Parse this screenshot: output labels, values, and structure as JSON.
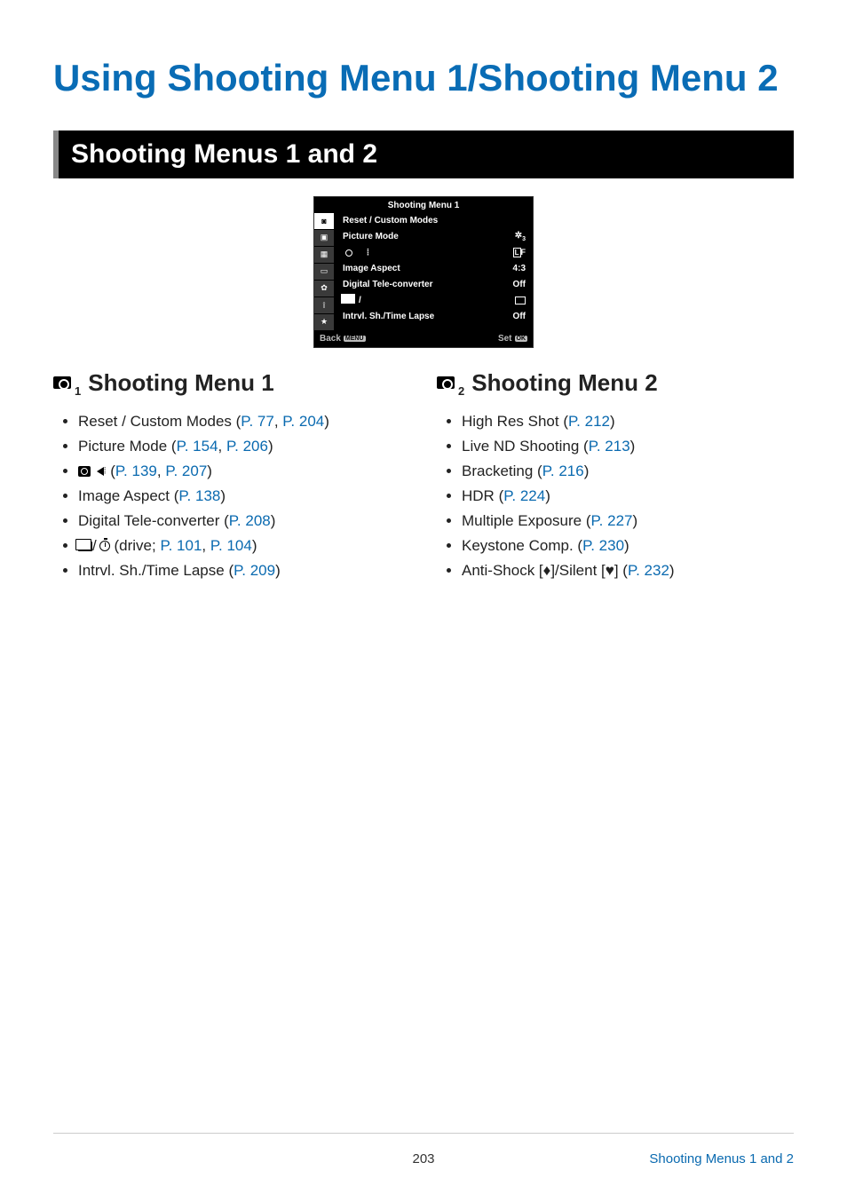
{
  "title": "Using Shooting Menu 1/Shooting Menu 2",
  "section_heading": "Shooting Menus 1 and 2",
  "lcd": {
    "title": "Shooting Menu 1",
    "rows": [
      {
        "label": "Reset / Custom Modes",
        "value": ""
      },
      {
        "label": "Picture Mode",
        "value": "icon-picmode"
      },
      {
        "label": "icon-quality",
        "value": "LF"
      },
      {
        "label": "Image Aspect",
        "value": "4:3"
      },
      {
        "label": "Digital Tele-converter",
        "value": "Off"
      },
      {
        "label": "icon-drive",
        "value": "icon-single"
      },
      {
        "label": "Intrvl. Sh./Time Lapse",
        "value": "Off"
      }
    ],
    "footer_back": "Back",
    "footer_back_key": "MENU",
    "footer_set": "Set",
    "footer_set_key": "OK"
  },
  "col1": {
    "heading": "Shooting Menu 1",
    "sub": "1",
    "items": [
      {
        "text": "Reset / Custom Modes",
        "refs": [
          {
            "t": "P. 77"
          },
          {
            "t": "P. 204"
          }
        ]
      },
      {
        "text": "Picture Mode",
        "refs": [
          {
            "t": "P. 154"
          },
          {
            "t": "P. 206"
          }
        ]
      },
      {
        "text": "icon-quality-row",
        "refs": [
          {
            "t": "P. 139"
          },
          {
            "t": "P. 207"
          }
        ]
      },
      {
        "text": "Image Aspect",
        "refs": [
          {
            "t": "P. 138"
          }
        ]
      },
      {
        "text": "Digital Tele-converter",
        "refs": [
          {
            "t": "P. 208"
          }
        ]
      },
      {
        "text": "icon-drive-row",
        "prefix": "drive;",
        "refs": [
          {
            "t": "P. 101"
          },
          {
            "t": "P. 104"
          }
        ]
      },
      {
        "text": "Intrvl. Sh./Time Lapse",
        "refs": [
          {
            "t": "P. 209"
          }
        ]
      }
    ]
  },
  "col2": {
    "heading": "Shooting Menu 2",
    "sub": "2",
    "items": [
      {
        "text": "High Res Shot",
        "refs": [
          {
            "t": "P. 212"
          }
        ]
      },
      {
        "text": "Live ND Shooting",
        "refs": [
          {
            "t": "P. 213"
          }
        ]
      },
      {
        "text": "Bracketing",
        "refs": [
          {
            "t": "P. 216"
          }
        ]
      },
      {
        "text": "HDR",
        "refs": [
          {
            "t": "P. 224"
          }
        ]
      },
      {
        "text": "Multiple Exposure",
        "refs": [
          {
            "t": "P. 227"
          }
        ]
      },
      {
        "text": "Keystone Comp.",
        "refs": [
          {
            "t": "P. 230"
          }
        ]
      },
      {
        "text": "Anti-Shock [♦]/Silent [♥]",
        "refs": [
          {
            "t": "P. 232"
          }
        ]
      }
    ]
  },
  "footer": {
    "page": "203",
    "crumb": "Shooting Menus 1 and 2"
  }
}
